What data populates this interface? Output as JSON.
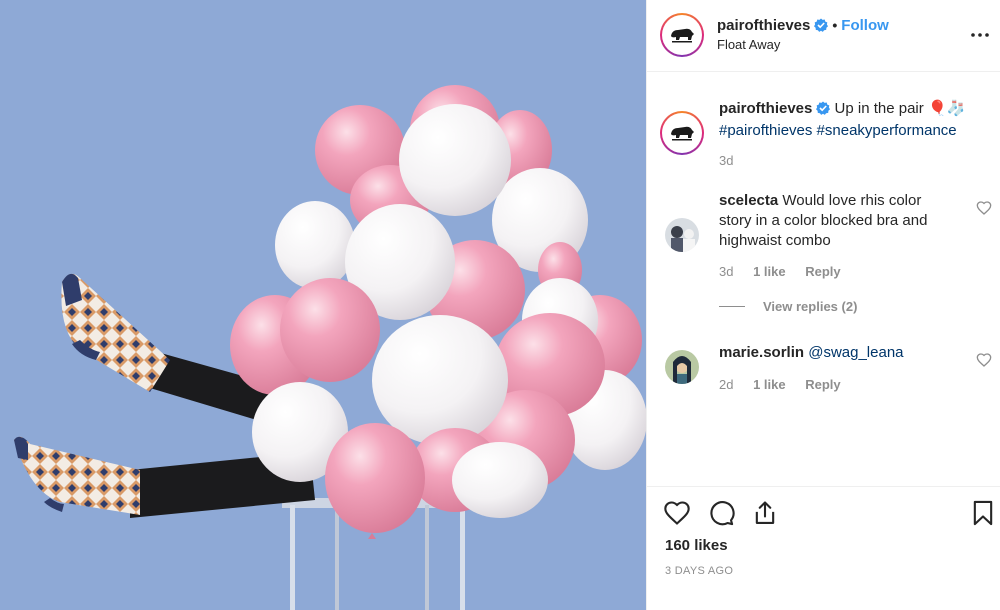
{
  "post": {
    "photo_alt": "Legs in patterned socks kicking out from behind a bunch of pink and white balloons on a clear stool",
    "username": "pairofthieves",
    "separator": "•",
    "follow_label": "Follow",
    "location": "Float Away"
  },
  "caption": {
    "username": "pairofthieves",
    "text": "Up in the pair",
    "emoji": "🎈🧦",
    "hashtags": "#pairofthieves #sneakyperformance",
    "age": "3d"
  },
  "comments": [
    {
      "username": "scelecta",
      "text": "Would love rhis color story in a color blocked bra and highwaist combo",
      "age": "3d",
      "likes": "1 like",
      "reply_label": "Reply",
      "view_replies": "View replies (2)"
    },
    {
      "username": "marie.sorlin",
      "mention": "@swag_leana",
      "age": "2d",
      "likes": "1 like",
      "reply_label": "Reply"
    }
  ],
  "footer": {
    "likes": "160 likes",
    "date": "3 DAYS AGO"
  },
  "colors": {
    "photo_background": "#8ea9d6",
    "link": "#3897f0",
    "hashtag": "#003569",
    "muted": "#8e8e8e",
    "text": "#262626"
  },
  "icons": [
    "verified-badge-icon",
    "more-options-icon",
    "heart-icon",
    "comment-icon",
    "share-icon",
    "bookmark-icon"
  ]
}
